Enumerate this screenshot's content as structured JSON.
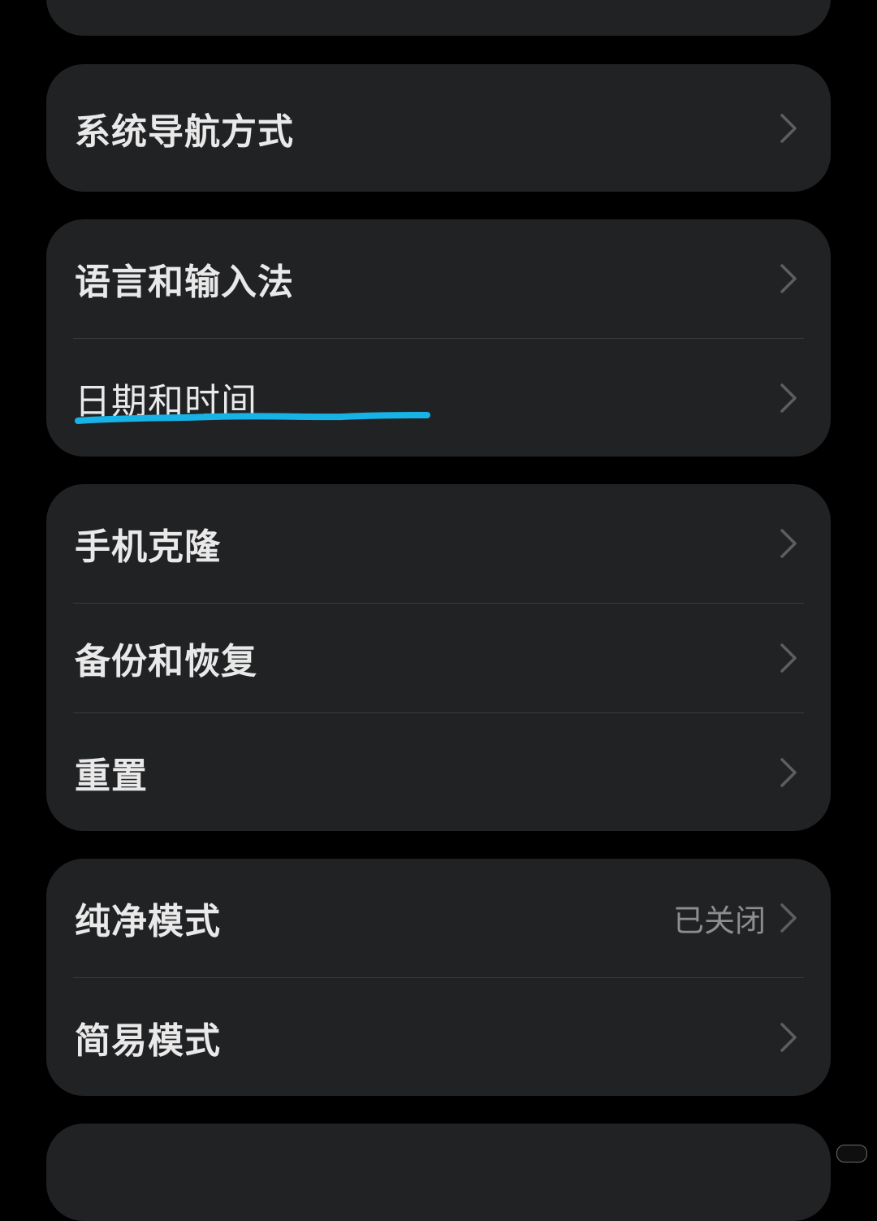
{
  "settings": {
    "nav_mode": "系统导航方式",
    "language_input": "语言和输入法",
    "date_time": "日期和时间",
    "phone_clone": "手机克隆",
    "backup_restore": "备份和恢复",
    "reset": "重置",
    "pure_mode": "纯净模式",
    "pure_mode_status": "已关闭",
    "simple_mode": "简易模式"
  },
  "icons": {
    "row_chevron": "chevron-right-icon"
  },
  "colors": {
    "background": "#000000",
    "card": "#212224",
    "text": "#e9e9e9",
    "secondary_text": "#8e8e90",
    "highlight_underline": "#17b3e6"
  }
}
